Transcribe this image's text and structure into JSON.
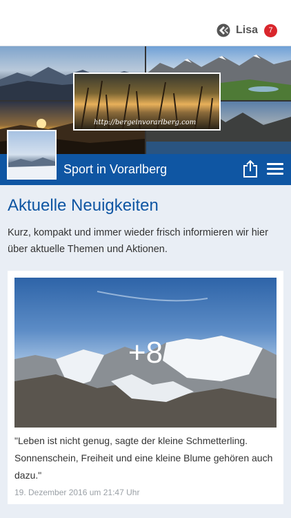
{
  "user": {
    "name": "Lisa",
    "notifications": "7",
    "logo_icon": "site-logo-icon"
  },
  "header": {
    "url_text": "http://bergeinvorarlberg.com",
    "nav_title": "Sport in Vorarlberg",
    "share_icon": "share-icon",
    "menu_icon": "hamburger-menu-icon"
  },
  "main": {
    "heading": "Aktuelle Neuigkeiten",
    "intro": "Kurz, kompakt und immer wieder frisch informieren wir hier über aktuelle Themen und Aktionen."
  },
  "post": {
    "more_count": "+8",
    "quote": "\"Leben ist nicht genug, sagte der kleine Schmetterling. Sonnenschein, Freiheit und eine kleine Blume gehören auch dazu.\"",
    "date": "19. Dezember 2016 um 21:47 Uhr"
  },
  "colors": {
    "accent": "#0f56a3",
    "badge": "#d9262c",
    "background": "#e9eef5"
  }
}
